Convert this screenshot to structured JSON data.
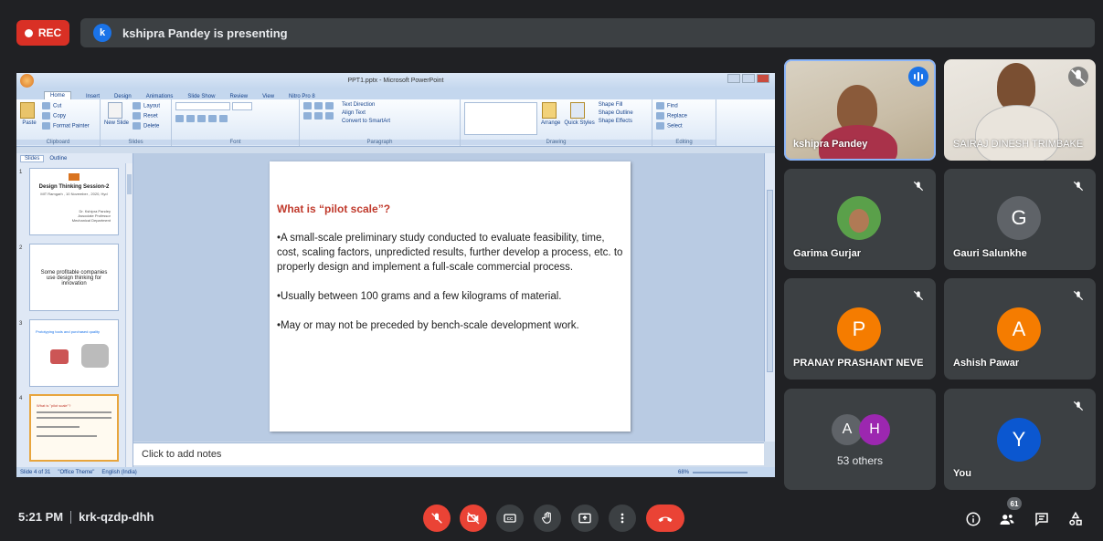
{
  "top": {
    "rec_label": "REC",
    "presenter_initial": "k",
    "presenting_text": "kshipra Pandey is presenting"
  },
  "powerpoint": {
    "window_title": "PPT1.pptx - Microsoft PowerPoint",
    "tabs": [
      "Home",
      "Insert",
      "Design",
      "Animations",
      "Slide Show",
      "Review",
      "View",
      "Nitro Pro 8"
    ],
    "clipboard": {
      "cut": "Cut",
      "copy": "Copy",
      "format_painter": "Format Painter",
      "paste": "Paste",
      "label": "Clipboard"
    },
    "slides_group": {
      "layout": "Layout",
      "reset": "Reset",
      "delete": "Delete",
      "new_slide": "New Slide",
      "label": "Slides"
    },
    "font_label": "Font",
    "paragraph": {
      "text_direction": "Text Direction",
      "align_text": "Align Text",
      "convert": "Convert to SmartArt",
      "label": "Paragraph"
    },
    "drawing": {
      "arrange": "Arrange",
      "quick_styles": "Quick Styles",
      "shape_fill": "Shape Fill",
      "shape_outline": "Shape Outline",
      "shape_effects": "Shape Effects",
      "label": "Drawing"
    },
    "editing": {
      "find": "Find",
      "replace": "Replace",
      "select": "Select",
      "label": "Editing"
    },
    "panel_tabs": {
      "slides": "Slides",
      "outline": "Outline"
    },
    "thumbnails": [
      {
        "num": "1",
        "title": "Design Thinking Session-2",
        "sub": "MIT Ramgarh , 10 November , 2020, Hyd",
        "right": "Dr. Kshipra Pandey\nAssociate Professor\nMechanical Department"
      },
      {
        "num": "2",
        "text": "Some profitable companies use design thinking for innovation"
      },
      {
        "num": "3",
        "text": "Prototyping tools and purchased quality"
      },
      {
        "num": "4",
        "text": "What is \"pilot scale\"?"
      }
    ],
    "slide": {
      "title": "What  is “pilot scale”?",
      "bullets": [
        "•A small-scale preliminary study conducted to evaluate feasibility, time, cost, scaling factors, unpredicted results, further develop a process, etc. to properly design and implement a full-scale commercial process.",
        "•Usually between 100 grams and a few kilograms of material.",
        "•May or may not be preceded by bench-scale development work."
      ]
    },
    "notes_placeholder": "Click to add notes",
    "status": {
      "slide": "Slide 4 of 31",
      "theme": "\"Office Theme\"",
      "lang": "English (India)",
      "zoom": "68%"
    }
  },
  "participants": [
    {
      "name": "kshipra Pandey",
      "speaking": true
    },
    {
      "name": "SAIRAJ DINESH TRIMBAKE",
      "muted": true
    },
    {
      "name": "Garima Gurjar",
      "muted": true
    },
    {
      "name": "Gauri Salunkhe",
      "initial": "G",
      "color": "#5f6368",
      "muted": true
    },
    {
      "name": "PRANAY PRASHANT NEVE",
      "initial": "P",
      "color": "#f57c00",
      "muted": true
    },
    {
      "name": "Ashish Pawar",
      "initial": "A",
      "color": "#f57c00",
      "muted": true
    },
    {
      "name": "53 others",
      "initials": [
        "A",
        "H"
      ],
      "colors": [
        "#5f6368",
        "#9c27b0"
      ]
    },
    {
      "name": "You",
      "initial": "Y",
      "color": "#0b57d0",
      "muted": true
    }
  ],
  "bottom": {
    "time": "5:21 PM",
    "meeting_code": "krk-qzdp-dhh",
    "people_count": "61"
  },
  "colors": {
    "accent": "#1a73e8",
    "danger": "#ea4335",
    "slide_title": "#c0392b"
  }
}
